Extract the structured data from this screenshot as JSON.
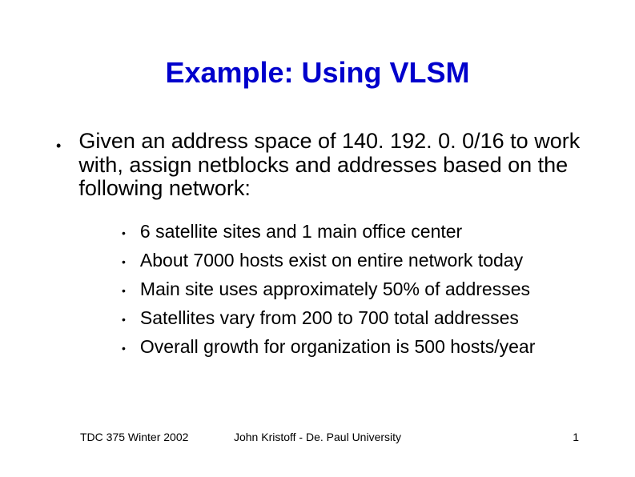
{
  "title": "Example: Using VLSM",
  "main_bullet": "Given an address space of 140. 192. 0. 0/16 to work with, assign netblocks and addresses based on the following network:",
  "sub_bullets": [
    "6 satellite sites and 1 main office center",
    "About 7000 hosts exist on entire network today",
    "Main site uses approximately 50% of addresses",
    "Satellites vary from 200 to 700 total addresses",
    "Overall growth for organization is 500 hosts/year"
  ],
  "footer": {
    "left": "TDC 375 Winter 2002",
    "center": "John Kristoff - De. Paul University",
    "right": "1"
  }
}
